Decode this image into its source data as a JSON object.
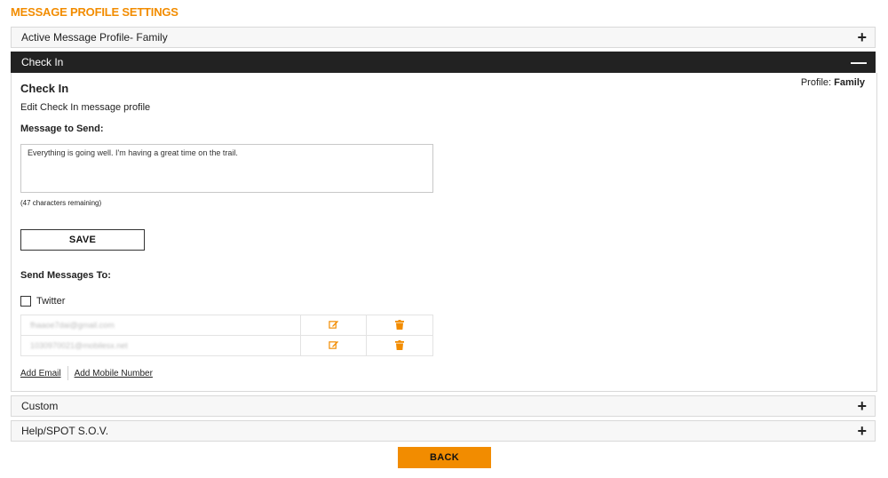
{
  "page": {
    "title": "MESSAGE PROFILE SETTINGS"
  },
  "accordion": {
    "active_profile": {
      "label": "Active Message Profile- Family",
      "toggle": "+"
    },
    "check_in": {
      "label": "Check In",
      "toggle": "—"
    },
    "custom": {
      "label": "Custom",
      "toggle": "+"
    },
    "help_sov": {
      "label": "Help/SPOT S.O.V.",
      "toggle": "+"
    }
  },
  "check_in_panel": {
    "title": "Check In",
    "profile_prefix": "Profile:",
    "profile_name": "Family",
    "subtitle": "Edit Check In message profile",
    "message_label": "Message to Send:",
    "message_value": "Everything is going well. I'm having a great time on the trail.",
    "chars_remaining": "(47 characters remaining)",
    "save_label": "SAVE",
    "send_to_label": "Send Messages To:",
    "twitter_label": "Twitter",
    "twitter_checked": false,
    "contacts": [
      {
        "address": "fhaaoe7dai@gmail.com",
        "edit_icon": "edit-icon",
        "delete_icon": "trash-icon"
      },
      {
        "address": "1030970021@mobilesx.net",
        "edit_icon": "edit-icon",
        "delete_icon": "trash-icon"
      }
    ],
    "add_email_label": "Add Email",
    "add_mobile_label": "Add Mobile Number"
  },
  "footer": {
    "back_label": "BACK"
  },
  "colors": {
    "accent": "#f28c00",
    "active_header_bg": "#222222",
    "panel_header_bg": "#f7f7f7"
  }
}
